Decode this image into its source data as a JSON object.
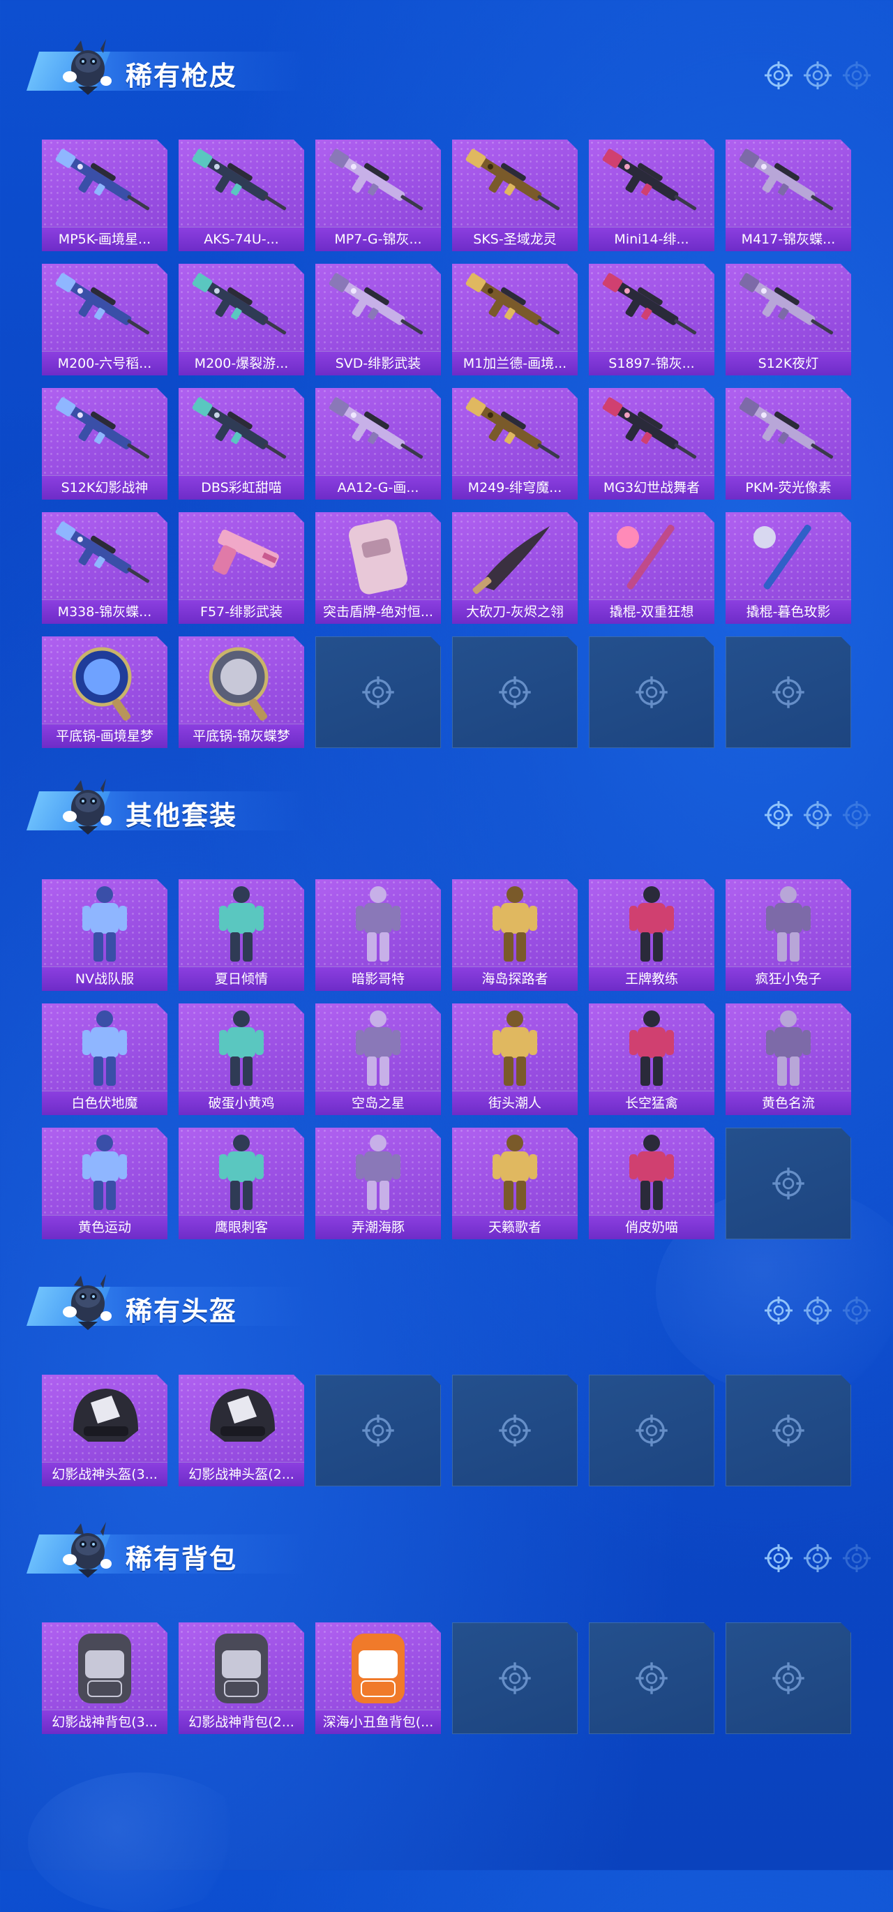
{
  "sections": [
    {
      "title": "稀有枪皮",
      "items": [
        {
          "label": "MP5K-画境星...",
          "icon": "gun-skin"
        },
        {
          "label": "AKS-74U-...",
          "icon": "gun-skin"
        },
        {
          "label": "MP7-G-锦灰...",
          "icon": "gun-skin"
        },
        {
          "label": "SKS-圣域龙灵",
          "icon": "gun-skin"
        },
        {
          "label": "Mini14-绯...",
          "icon": "gun-skin"
        },
        {
          "label": "M417-锦灰蝶...",
          "icon": "gun-skin"
        },
        {
          "label": "M200-六号稻...",
          "icon": "gun-skin"
        },
        {
          "label": "M200-爆裂游...",
          "icon": "gun-skin"
        },
        {
          "label": "SVD-绯影武装",
          "icon": "gun-skin"
        },
        {
          "label": "M1加兰德-画境...",
          "icon": "gun-skin"
        },
        {
          "label": "S1897-锦灰...",
          "icon": "gun-skin"
        },
        {
          "label": "S12K夜灯",
          "icon": "gun-skin"
        },
        {
          "label": "S12K幻影战神",
          "icon": "gun-skin"
        },
        {
          "label": "DBS彩虹甜喵",
          "icon": "gun-skin"
        },
        {
          "label": "AA12-G-画...",
          "icon": "gun-skin"
        },
        {
          "label": "M249-绯穹魔...",
          "icon": "gun-skin"
        },
        {
          "label": "MG3幻世战舞者",
          "icon": "gun-skin"
        },
        {
          "label": "PKM-荧光像素",
          "icon": "gun-skin"
        },
        {
          "label": "M338-锦灰蝶...",
          "icon": "gun-skin"
        },
        {
          "label": "F57-绯影武装",
          "icon": "pistol-skin"
        },
        {
          "label": "突击盾牌-绝对恒...",
          "icon": "shield-skin"
        },
        {
          "label": "大砍刀-灰烬之翎",
          "icon": "machete-skin"
        },
        {
          "label": "撬棍-双重狂想",
          "icon": "crowbar-skin"
        },
        {
          "label": "撬棍-暮色玫影",
          "icon": "crowbar-skin"
        },
        {
          "label": "平底锅-画境星梦",
          "icon": "pan-skin"
        },
        {
          "label": "平底锅-锦灰蝶梦",
          "icon": "pan-skin"
        }
      ],
      "empty_slots": 4
    },
    {
      "title": "其他套装",
      "items": [
        {
          "label": "NV战队服",
          "icon": "outfit"
        },
        {
          "label": "夏日倾情",
          "icon": "outfit"
        },
        {
          "label": "暗影哥特",
          "icon": "outfit"
        },
        {
          "label": "海岛探路者",
          "icon": "outfit"
        },
        {
          "label": "王牌教练",
          "icon": "outfit"
        },
        {
          "label": "疯狂小兔子",
          "icon": "outfit"
        },
        {
          "label": "白色伏地魔",
          "icon": "outfit"
        },
        {
          "label": "破蛋小黄鸡",
          "icon": "outfit"
        },
        {
          "label": "空岛之星",
          "icon": "outfit"
        },
        {
          "label": "街头潮人",
          "icon": "outfit"
        },
        {
          "label": "长空猛禽",
          "icon": "outfit"
        },
        {
          "label": "黄色名流",
          "icon": "outfit"
        },
        {
          "label": "黄色运动",
          "icon": "outfit"
        },
        {
          "label": "鹰眼刺客",
          "icon": "outfit"
        },
        {
          "label": "弄潮海豚",
          "icon": "outfit"
        },
        {
          "label": "天籁歌者",
          "icon": "outfit"
        },
        {
          "label": "俏皮奶喵",
          "icon": "outfit"
        }
      ],
      "empty_slots": 1
    },
    {
      "title": "稀有头盔",
      "items": [
        {
          "label": "幻影战神头盔(3...",
          "icon": "helmet"
        },
        {
          "label": "幻影战神头盔(2...",
          "icon": "helmet"
        }
      ],
      "empty_slots": 4
    },
    {
      "title": "稀有背包",
      "items": [
        {
          "label": "幻影战神背包(3...",
          "icon": "backpack"
        },
        {
          "label": "幻影战神背包(2...",
          "icon": "backpack"
        },
        {
          "label": "深海小丑鱼背包(...",
          "icon": "backpack"
        }
      ],
      "empty_slots": 3
    }
  ],
  "colors": {
    "background": "#0b48c8",
    "card_purple": "#a657ea",
    "label_purple": "#7a33d0",
    "empty_slot": "#21498a"
  }
}
